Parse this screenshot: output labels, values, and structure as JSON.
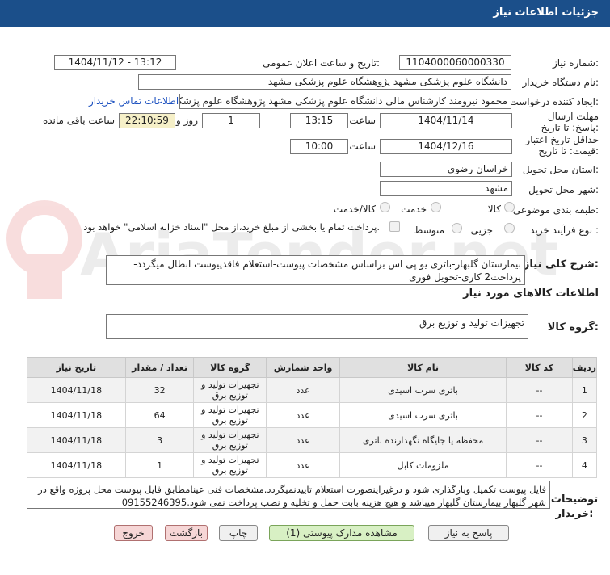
{
  "header": {
    "title": "جزئیات اطلاعات نیاز"
  },
  "form": {
    "need_number_label": "شماره نیاز:",
    "need_number": "1104000060000330",
    "announce_label": "تاریخ و ساعت اعلان عمومی:",
    "announce_value": "1404/11/12 - 13:12",
    "buyer_org_label": "نام دستگاه خریدار:",
    "buyer_org": "دانشگاه علوم پزشکی مشهد   پژوهشگاه علوم پزشکی مشهد",
    "requester_label": "ایجاد کننده درخواست:",
    "requester": "محمود نیرومند کارشناس مالی دانشگاه علوم پزشکی مشهد   پژوهشگاه علوم پزشکی مشهد",
    "contact_link": "اطلاعات تماس خریدار",
    "reply_deadline_label": "مهلت ارسال پاسخ: تا تاریخ:",
    "reply_date": "1404/11/14",
    "time_label": "ساعت",
    "reply_time": "13:15",
    "days_value": "1",
    "days_label": "روز و",
    "remaining_time": "22:10:59",
    "remaining_label": "ساعت باقی مانده",
    "validity_label": "حداقل تاریخ اعتبار قیمت: تا تاریخ:",
    "validity_date": "1404/12/16",
    "validity_time": "10:00",
    "province_label": "استان محل تحویل:",
    "province": "خراسان رضوی",
    "city_label": "شهر محل تحویل:",
    "city": "مشهد",
    "category_label": "طبقه بندی موضوعی:",
    "category_options": [
      "کالا",
      "خدمت",
      "کالا/خدمت"
    ],
    "process_label": "نوع فرآیند خرید :",
    "process_options": [
      "جزیی",
      "متوسط"
    ],
    "payment_note": "پرداخت تمام یا بخشی از مبلغ خرید،از محل \"اسناد خزانه اسلامی\" خواهد بود."
  },
  "summary": {
    "label": "شرح کلی نیاز:",
    "text": "بیمارستان گلبهار-باتری یو پی اس براساس مشخصات پیوست-استعلام فاقدپیوست ابطال میگردد-پرداخت2 کاری-تحویل فوری"
  },
  "goods": {
    "section_title": "اطلاعات کالاهای مورد نیاز",
    "group_label": "گروه کالا:",
    "group_value": "تجهیزات تولید و توزیع برق",
    "columns": [
      "ردیف",
      "کد کالا",
      "نام کالا",
      "واحد شمارش",
      "گروه کالا",
      "تعداد / مقدار",
      "تاریخ نیاز"
    ],
    "rows": [
      {
        "idx": "1",
        "code": "--",
        "name": "باتری سرب اسیدی",
        "unit": "عدد",
        "group": "تجهیزات تولید و توزیع برق",
        "qty": "32",
        "date": "1404/11/18"
      },
      {
        "idx": "2",
        "code": "--",
        "name": "باتری سرب اسیدی",
        "unit": "عدد",
        "group": "تجهیزات تولید و توزیع برق",
        "qty": "64",
        "date": "1404/11/18"
      },
      {
        "idx": "3",
        "code": "--",
        "name": "محفظه یا جایگاه نگهدارنده باتری",
        "unit": "عدد",
        "group": "تجهیزات تولید و توزیع برق",
        "qty": "3",
        "date": "1404/11/18"
      },
      {
        "idx": "4",
        "code": "--",
        "name": "ملزومات کابل",
        "unit": "عدد",
        "group": "تجهیزات تولید و توزیع برق",
        "qty": "1",
        "date": "1404/11/18"
      }
    ]
  },
  "notes": {
    "label": "توضیحات خریدار:",
    "text": "فایل پیوست تکمیل وبارگذاری شود و درغیراینصورت استعلام تاییدنمیگردد.مشخصات فنی عینامطابق فایل پیوست محل پروژه واقع در شهر گلبهار بیمارستان گلبهار میباشد و هیچ هزینه بابت حمل و تخلیه و نصب پرداخت نمی شود.09155246395"
  },
  "buttons": {
    "reply": "پاسخ به نیاز",
    "attachments": "مشاهده مدارک پیوستی (1)",
    "print": "چاپ",
    "back": "بازگشت",
    "exit": "خروج"
  },
  "watermark": {
    "text": "AriaTender.net"
  },
  "colors": {
    "header_bg": "#1b4f8a",
    "link": "#1a4fbf",
    "highlight": "#f6f0c8"
  }
}
